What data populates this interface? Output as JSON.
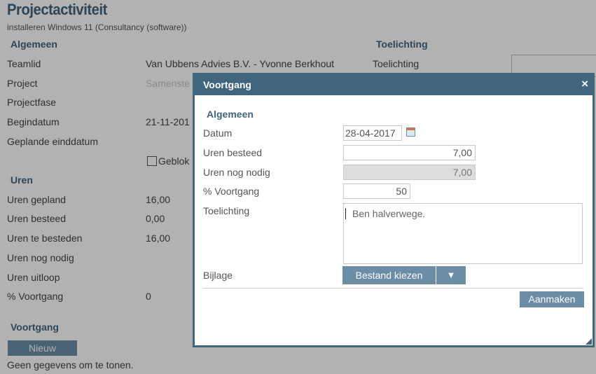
{
  "page": {
    "title": "Projectactiviteit",
    "subtitle": "installeren Windows 11 (Consultancy (software))",
    "section_general": "Algemeen",
    "section_notes": "Toelichting",
    "fields": [
      {
        "label": "Teamlid",
        "value": "Van Ubbens Advies B.V. - Yvonne Berkhout"
      },
      {
        "label": "Project",
        "value": "Samenste"
      },
      {
        "label": "Projectfase",
        "value": ""
      },
      {
        "label": "Begindatum",
        "value": "21-11-201"
      },
      {
        "label": "Geplande einddatum",
        "value": ""
      }
    ],
    "notes_label": "Toelichting",
    "blocked_label": "Geblok",
    "section_hours": "Uren",
    "hours": [
      {
        "label": "Uren gepland",
        "value": "16,00"
      },
      {
        "label": "Uren besteed",
        "value": "0,00"
      },
      {
        "label": "Uren te besteden",
        "value": "16,00"
      },
      {
        "label": "Uren nog nodig",
        "value": ""
      },
      {
        "label": "Uren uitloop",
        "value": ""
      },
      {
        "label": "% Voortgang",
        "value": "0"
      }
    ],
    "section_progress": "Voortgang",
    "new_button": "Nieuw",
    "empty_text": "Geen gegevens om te tonen."
  },
  "dialog": {
    "title": "Voortgang",
    "close_glyph": "×",
    "section": "Algemeen",
    "date_label": "Datum",
    "date_value": "28-04-2017",
    "spent_label": "Uren besteed",
    "spent_value": "7,00",
    "remaining_label": "Uren nog nodig",
    "remaining_value": "7,00",
    "progress_label": "% Voortgang",
    "progress_value": "50",
    "notes_label": "Toelichting",
    "notes_value": "Ben halverwege.",
    "attachment_label": "Bijlage",
    "file_button": "Bestand kiezen",
    "file_dropdown": "▼",
    "create_button": "Aanmaken"
  },
  "colors": {
    "accent": "#40657f",
    "button": "#6b8ea6"
  }
}
